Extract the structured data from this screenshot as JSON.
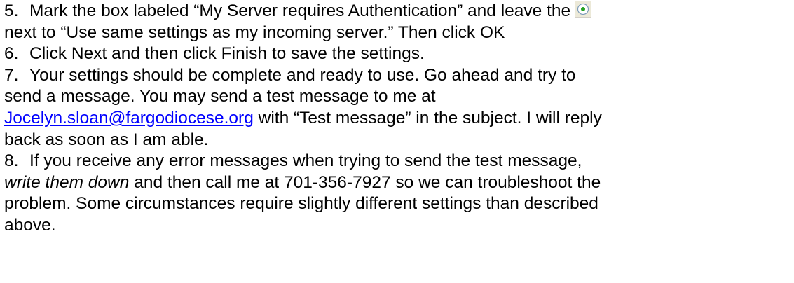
{
  "steps": [
    {
      "number": "5.",
      "line1": "Mark the box labeled “My Server requires Authentication”  and leave the",
      "radio_icon": "radio-button-selected-icon",
      "line2": "next to “Use same settings as my incoming server.” Then click OK"
    },
    {
      "number": "6.",
      "line1": "Click Next and then click Finish to save the settings."
    },
    {
      "number": "7.",
      "line1": "Your settings should be complete and ready to use. Go ahead and try to",
      "line2": "send a message. You may send a test message to me at",
      "email": "Jocelyn.sloan@fargodiocese.org",
      "line3_after_email": " with “Test message” in the subject. I will reply",
      "line4": "back as soon as I am able."
    },
    {
      "number": "8.",
      "line1": "If you receive any error messages when trying to send the test message,",
      "line2_italic": "write them down",
      "line2_rest": " and then call me at 701-356-7927 so we can troubleshoot the",
      "line3": "problem. Some circumstances require slightly different settings than described",
      "line4": "above."
    }
  ],
  "colors": {
    "text": "#000000",
    "link": "#0000ff",
    "background": "#ffffff"
  }
}
